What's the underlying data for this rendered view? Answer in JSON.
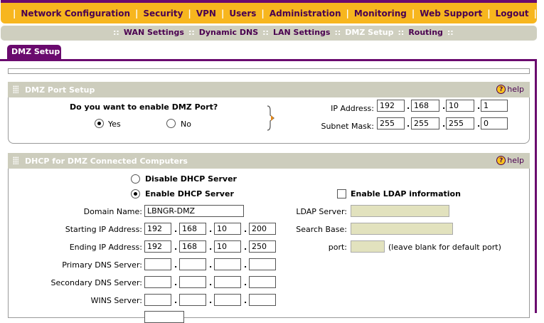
{
  "topnav": {
    "items": [
      "Network Configuration",
      "Security",
      "VPN",
      "Users",
      "Administration",
      "Monitoring",
      "Web Support",
      "Logout"
    ]
  },
  "subnav": {
    "items": [
      "WAN Settings",
      "Dynamic DNS",
      "LAN Settings",
      "DMZ Setup",
      "Routing"
    ]
  },
  "tab": {
    "label": "DMZ Setup"
  },
  "dmz_port": {
    "title": "DMZ Port Setup",
    "help": "help",
    "question": "Do you want to enable DMZ Port?",
    "yes_label": "Yes",
    "no_label": "No",
    "ip_label": "IP Address:",
    "ip": [
      "192",
      "168",
      "10",
      "1"
    ],
    "mask_label": "Subnet Mask:",
    "mask": [
      "255",
      "255",
      "255",
      "0"
    ]
  },
  "dhcp": {
    "title": "DHCP for DMZ Connected Computers",
    "help": "help",
    "disable_label": "Disable DHCP Server",
    "enable_label": "Enable DHCP Server",
    "ldap_enable_label": "Enable LDAP information",
    "domain_label": "Domain Name:",
    "domain_value": "LBNGR-DMZ",
    "start_label": "Starting IP Address:",
    "start_ip": [
      "192",
      "168",
      "10",
      "200"
    ],
    "end_label": "Ending IP Address:",
    "end_ip": [
      "192",
      "168",
      "10",
      "250"
    ],
    "primary_dns_label": "Primary DNS Server:",
    "secondary_dns_label": "Secondary DNS Server:",
    "wins_label": "WINS Server:",
    "ldap_server_label": "LDAP Server:",
    "search_base_label": "Search Base:",
    "port_label": "port:",
    "port_hint": "(leave blank for default port)"
  }
}
